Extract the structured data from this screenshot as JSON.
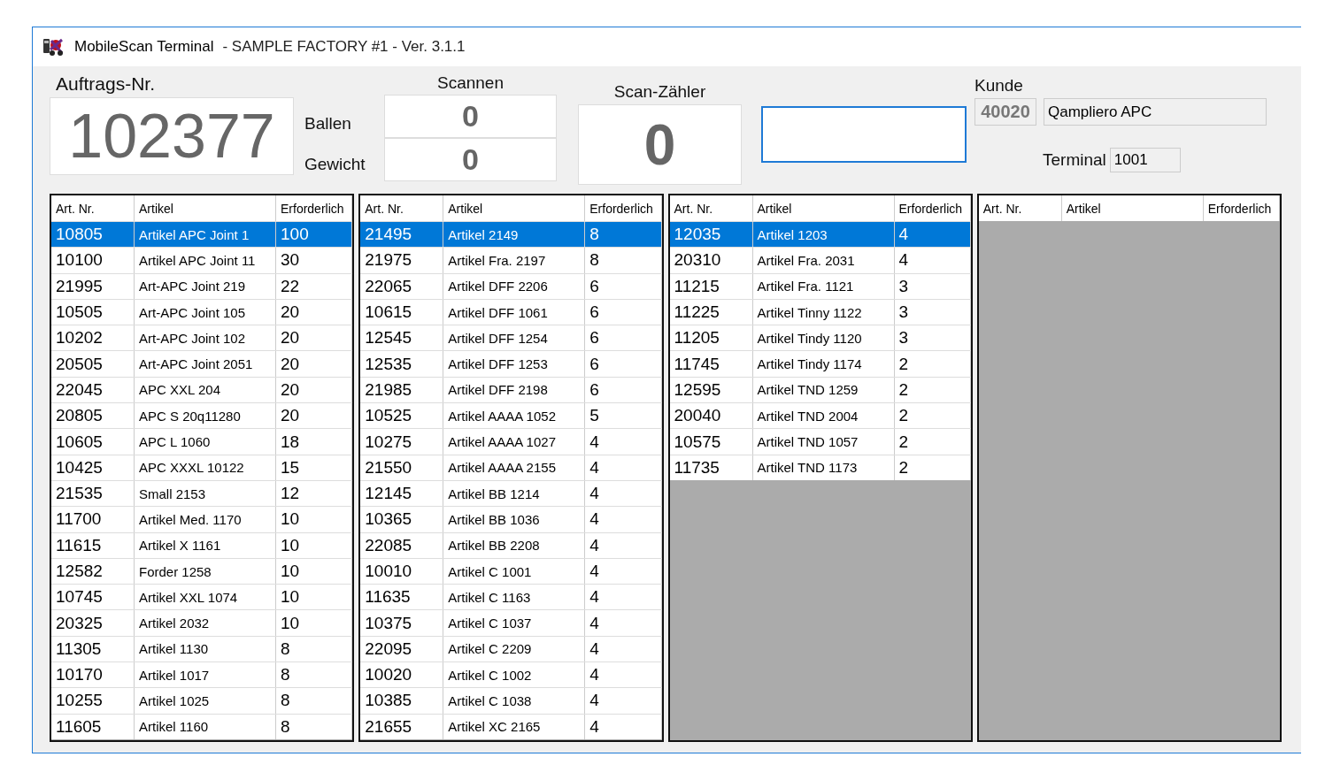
{
  "window": {
    "title": "MobileScan Terminal",
    "subtitle": "- SAMPLE FACTORY #1 - Ver. 3.1.1"
  },
  "order": {
    "label": "Auftrags-Nr.",
    "value": "102377"
  },
  "scan": {
    "label": "Scannen",
    "ballen_label": "Ballen",
    "ballen_value": "0",
    "gewicht_label": "Gewicht",
    "gewicht_value": "0"
  },
  "counter": {
    "label": "Scan-Zähler",
    "value": "0"
  },
  "scan_input": {
    "focused": true
  },
  "customer": {
    "label": "Kunde",
    "number": "40020",
    "name": "Qampliero APC",
    "terminal_label": "Terminal",
    "terminal_value": "1001"
  },
  "tables": [
    {
      "columns": [
        "Art. Nr.",
        "Artikel",
        "Erforderlich"
      ],
      "rows": [
        {
          "art_nr": "10805",
          "artikel": "Artikel APC Joint 1",
          "erforderlich": "100",
          "selected": true
        },
        {
          "art_nr": "10100",
          "artikel": "Artikel APC Joint 11",
          "erforderlich": "30",
          "selected": false
        },
        {
          "art_nr": "21995",
          "artikel": "Art-APC Joint 219",
          "erforderlich": "22",
          "selected": false
        },
        {
          "art_nr": "10505",
          "artikel": "Art-APC Joint 105",
          "erforderlich": "20",
          "selected": false
        },
        {
          "art_nr": "10202",
          "artikel": "Art-APC Joint 102",
          "erforderlich": "20",
          "selected": false
        },
        {
          "art_nr": "20505",
          "artikel": "Art-APC Joint 2051",
          "erforderlich": "20",
          "selected": false
        },
        {
          "art_nr": "22045",
          "artikel": "APC XXL 204",
          "erforderlich": "20",
          "selected": false
        },
        {
          "art_nr": "20805",
          "artikel": "APC S 20q11280",
          "erforderlich": "20",
          "selected": false
        },
        {
          "art_nr": "10605",
          "artikel": "APC L 1060",
          "erforderlich": "18",
          "selected": false
        },
        {
          "art_nr": "10425",
          "artikel": "APC XXXL 10122",
          "erforderlich": "15",
          "selected": false
        },
        {
          "art_nr": "21535",
          "artikel": "Small 2153",
          "erforderlich": "12",
          "selected": false
        },
        {
          "art_nr": "11700",
          "artikel": "Artikel Med. 1170",
          "erforderlich": "10",
          "selected": false
        },
        {
          "art_nr": "11615",
          "artikel": "Artikel X 1161",
          "erforderlich": "10",
          "selected": false
        },
        {
          "art_nr": "12582",
          "artikel": "Forder 1258",
          "erforderlich": "10",
          "selected": false
        },
        {
          "art_nr": "10745",
          "artikel": "Artikel XXL 1074",
          "erforderlich": "10",
          "selected": false
        },
        {
          "art_nr": "20325",
          "artikel": "Artikel 2032",
          "erforderlich": "10",
          "selected": false
        },
        {
          "art_nr": "11305",
          "artikel": "Artikel 1130",
          "erforderlich": "8",
          "selected": false
        },
        {
          "art_nr": "10170",
          "artikel": "Artikel 1017",
          "erforderlich": "8",
          "selected": false
        },
        {
          "art_nr": "10255",
          "artikel": "Artikel 1025",
          "erforderlich": "8",
          "selected": false
        },
        {
          "art_nr": "11605",
          "artikel": "Artikel 1160",
          "erforderlich": "8",
          "selected": false
        }
      ]
    },
    {
      "columns": [
        "Art. Nr.",
        "Artikel",
        "Erforderlich"
      ],
      "rows": [
        {
          "art_nr": "21495",
          "artikel": "Artikel 2149",
          "erforderlich": "8",
          "selected": true
        },
        {
          "art_nr": "21975",
          "artikel": "Artikel Fra. 2197",
          "erforderlich": "8",
          "selected": false
        },
        {
          "art_nr": "22065",
          "artikel": "Artikel DFF 2206",
          "erforderlich": "6",
          "selected": false
        },
        {
          "art_nr": "10615",
          "artikel": "Artikel DFF 1061",
          "erforderlich": "6",
          "selected": false
        },
        {
          "art_nr": "12545",
          "artikel": "Artikel DFF 1254",
          "erforderlich": "6",
          "selected": false
        },
        {
          "art_nr": "12535",
          "artikel": "Artikel DFF 1253",
          "erforderlich": "6",
          "selected": false
        },
        {
          "art_nr": "21985",
          "artikel": "Artikel DFF 2198",
          "erforderlich": "6",
          "selected": false
        },
        {
          "art_nr": "10525",
          "artikel": "Artikel AAAA 1052",
          "erforderlich": "5",
          "selected": false
        },
        {
          "art_nr": "10275",
          "artikel": "Artikel AAAA 1027",
          "erforderlich": "4",
          "selected": false
        },
        {
          "art_nr": "21550",
          "artikel": "Artikel AAAA 2155",
          "erforderlich": "4",
          "selected": false
        },
        {
          "art_nr": "12145",
          "artikel": "Artikel BB 1214",
          "erforderlich": "4",
          "selected": false
        },
        {
          "art_nr": "10365",
          "artikel": "Artikel BB 1036",
          "erforderlich": "4",
          "selected": false
        },
        {
          "art_nr": "22085",
          "artikel": "Artikel BB 2208",
          "erforderlich": "4",
          "selected": false
        },
        {
          "art_nr": "10010",
          "artikel": "Artikel C 1001",
          "erforderlich": "4",
          "selected": false
        },
        {
          "art_nr": "11635",
          "artikel": "Artikel C 1163",
          "erforderlich": "4",
          "selected": false
        },
        {
          "art_nr": "10375",
          "artikel": "Artikel C 1037",
          "erforderlich": "4",
          "selected": false
        },
        {
          "art_nr": "22095",
          "artikel": "Artikel C 2209",
          "erforderlich": "4",
          "selected": false
        },
        {
          "art_nr": "10020",
          "artikel": "Artikel C 1002",
          "erforderlich": "4",
          "selected": false
        },
        {
          "art_nr": "10385",
          "artikel": "Artikel C 1038",
          "erforderlich": "4",
          "selected": false
        },
        {
          "art_nr": "21655",
          "artikel": "Artikel XC 2165",
          "erforderlich": "4",
          "selected": false
        }
      ]
    },
    {
      "columns": [
        "Art. Nr.",
        "Artikel",
        "Erforderlich"
      ],
      "rows": [
        {
          "art_nr": "12035",
          "artikel": "Artikel 1203",
          "erforderlich": "4",
          "selected": true
        },
        {
          "art_nr": "20310",
          "artikel": "Artikel Fra. 2031",
          "erforderlich": "4",
          "selected": false
        },
        {
          "art_nr": "11215",
          "artikel": "Artikel Fra. 1121",
          "erforderlich": "3",
          "selected": false
        },
        {
          "art_nr": "11225",
          "artikel": "Artikel Tinny 1122",
          "erforderlich": "3",
          "selected": false
        },
        {
          "art_nr": "11205",
          "artikel": "Artikel Tindy 1120",
          "erforderlich": "3",
          "selected": false
        },
        {
          "art_nr": "11745",
          "artikel": "Artikel Tindy  1174",
          "erforderlich": "2",
          "selected": false
        },
        {
          "art_nr": "12595",
          "artikel": "Artikel TND 1259",
          "erforderlich": "2",
          "selected": false
        },
        {
          "art_nr": "20040",
          "artikel": "Artikel TND 2004",
          "erforderlich": "2",
          "selected": false
        },
        {
          "art_nr": "10575",
          "artikel": "Artikel TND 1057",
          "erforderlich": "2",
          "selected": false
        },
        {
          "art_nr": "11735",
          "artikel": "Artikel TND 1173",
          "erforderlich": "2",
          "selected": false
        }
      ]
    },
    {
      "columns": [
        "Art. Nr.",
        "Artikel",
        "Erforderlich"
      ]
    }
  ]
}
